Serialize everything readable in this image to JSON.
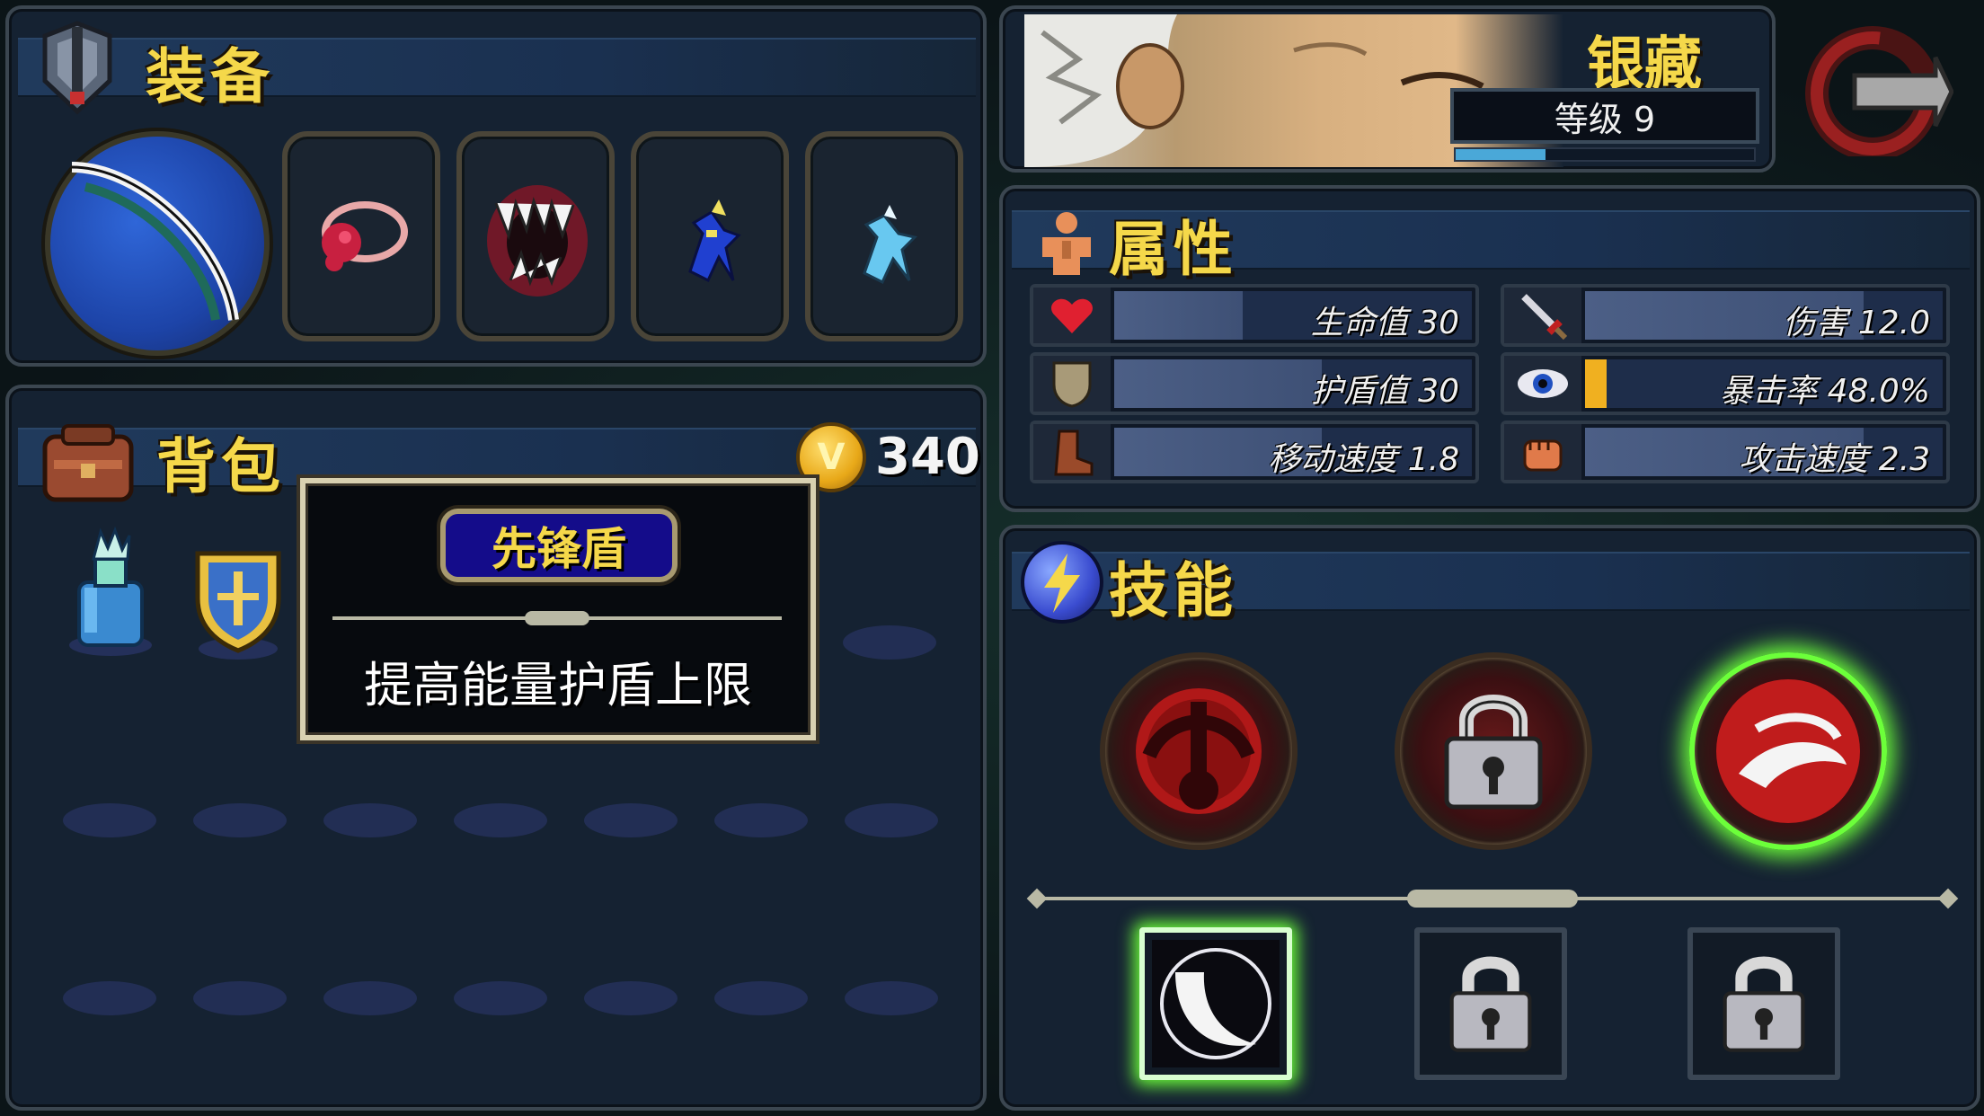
{
  "equipment": {
    "title": "装备",
    "slots": [
      "bow-weapon-icon",
      "red-amulet-icon",
      "fang-relic-icon",
      "blue-spirit-icon",
      "cyan-spirit-icon"
    ]
  },
  "backpack": {
    "title": "背包",
    "gold": "340",
    "items": [
      "potion-bottle-icon",
      "shield-badge-icon"
    ]
  },
  "tooltip": {
    "name": "先锋盾",
    "description": "提高能量护盾上限"
  },
  "character": {
    "name": "银藏",
    "level_label": "等级 9",
    "xp_fraction": 0.3
  },
  "attributes": {
    "title": "属性",
    "stats": [
      {
        "label": "生命值 30",
        "icon": "heart-icon",
        "fill": 0.36
      },
      {
        "label": "伤害 12.0",
        "icon": "sword-icon",
        "fill": 0.78
      },
      {
        "label": "护盾值 30",
        "icon": "shield-icon",
        "fill": 0.58
      },
      {
        "label": "暴击率 48.0%",
        "icon": "eye-icon",
        "fill": 0.06,
        "accent": "#f0b020"
      },
      {
        "label": "移动速度 1.8",
        "icon": "boot-icon",
        "fill": 0.58
      },
      {
        "label": "攻击速度 2.3",
        "icon": "fist-icon",
        "fill": 0.78
      }
    ]
  },
  "skills": {
    "title": "技能",
    "active": [
      "bow-emblem-skill",
      "locked-skill",
      "slash-skill-selected"
    ],
    "passive": [
      "crescent-skill-selected",
      "locked-passive",
      "locked-passive"
    ]
  },
  "colors": {
    "accent": "#f5d84a",
    "select_green": "#6cff3a",
    "panel": "#152232"
  }
}
